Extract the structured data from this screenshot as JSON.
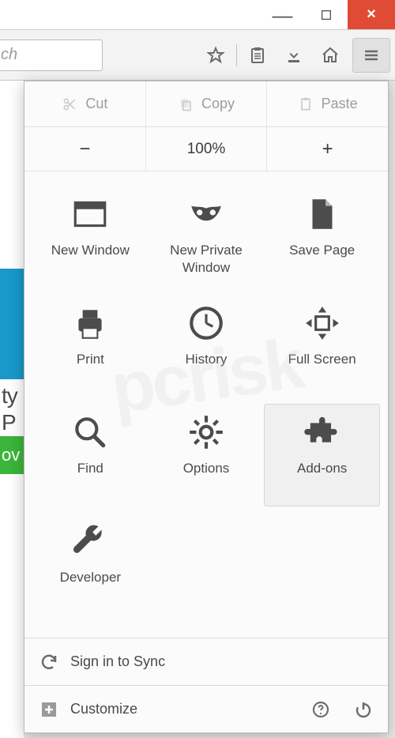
{
  "window": {
    "min_tooltip": "Minimize",
    "max_tooltip": "Maximize",
    "close_tooltip": "Close"
  },
  "toolbar": {
    "search_placeholder": "ch",
    "bookmark_tooltip": "Bookmark this page",
    "clipboard_tooltip": "Show your bookmarks",
    "downloads_tooltip": "Downloads",
    "home_tooltip": "Home",
    "menu_tooltip": "Open menu"
  },
  "clipboard": {
    "cut": "Cut",
    "copy": "Copy",
    "paste": "Paste"
  },
  "zoom": {
    "out": "−",
    "value": "100%",
    "in": "+"
  },
  "grid": {
    "new_window": "New Window",
    "new_private": "New Private\nWindow",
    "save_page": "Save Page",
    "print": "Print",
    "history": "History",
    "full_screen": "Full Screen",
    "find": "Find",
    "options": "Options",
    "addons": "Add-ons",
    "developer": "Developer"
  },
  "footer": {
    "sync": "Sign in to Sync",
    "customize": "Customize",
    "help_tooltip": "Help",
    "quit_tooltip": "Quit"
  },
  "page_bg": {
    "line1": "ty",
    "line2": "P",
    "green": "ov"
  }
}
